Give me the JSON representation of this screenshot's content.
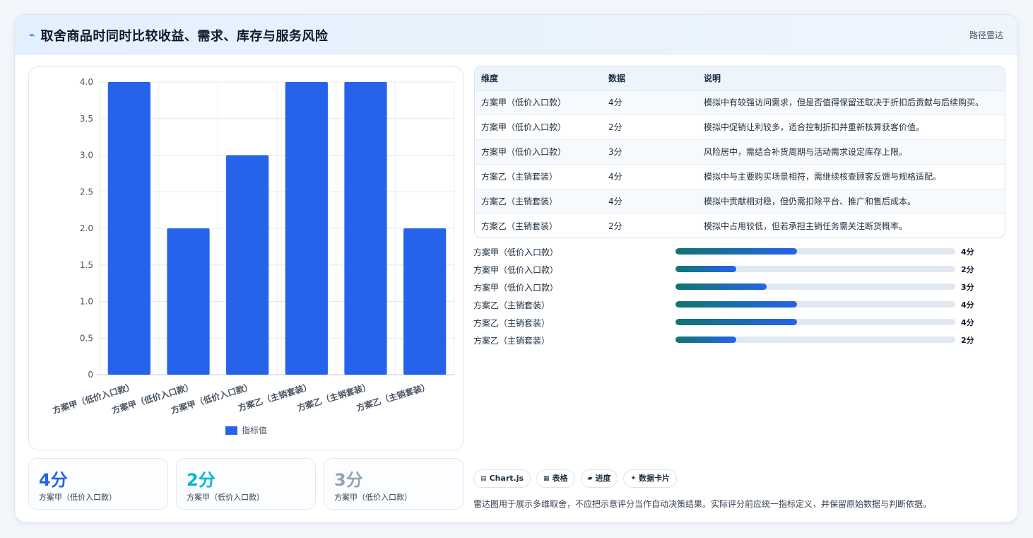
{
  "header": {
    "title": "取舍商品时同时比较收益、需求、库存与服务风险",
    "badge": "路径雷达",
    "title_icon": "trend-icon"
  },
  "chart_data": {
    "type": "bar",
    "categories": [
      "方案甲（低价入口款）",
      "方案甲（低价入口款）",
      "方案甲（低价入口款）",
      "方案乙（主销套装）",
      "方案乙（主销套装）",
      "方案乙（主销套装）"
    ],
    "series": [
      {
        "name": "指标值",
        "values": [
          4,
          2,
          3,
          4,
          4,
          2
        ]
      }
    ],
    "ylim": [
      0,
      4
    ],
    "yticks": [
      "0",
      "0.5",
      "1.0",
      "1.5",
      "2.0",
      "2.5",
      "3.0",
      "3.5",
      "4.0"
    ],
    "grid": true,
    "legend": "bottom",
    "bar_color": "#2563eb"
  },
  "stats": [
    {
      "value": "4分",
      "label": "方案甲（低价入口款）",
      "color": "#2563eb"
    },
    {
      "value": "2分",
      "label": "方案甲（低价入口款）",
      "color": "#06b6d4"
    },
    {
      "value": "3分",
      "label": "方案甲（低价入口款）",
      "color": "#94a3b8"
    }
  ],
  "table": {
    "headers": [
      "维度",
      "数据",
      "说明"
    ],
    "rows": [
      [
        "方案甲（低价入口款）",
        "4分",
        "模拟中有较强访问需求，但是否值得保留还取决于折扣后贡献与后续购买。"
      ],
      [
        "方案甲（低价入口款）",
        "2分",
        "模拟中促销让利较多，适合控制折扣并重新核算获客价值。"
      ],
      [
        "方案甲（低价入口款）",
        "3分",
        "风险居中，需结合补货周期与活动需求设定库存上限。"
      ],
      [
        "方案乙（主销套装）",
        "4分",
        "模拟中与主要购买场景相符，需继续核查顾客反馈与规格适配。"
      ],
      [
        "方案乙（主销套装）",
        "4分",
        "模拟中贡献相对稳，但仍需扣除平台、推广和售后成本。"
      ],
      [
        "方案乙（主销套装）",
        "2分",
        "模拟中占用较低，但若承担主销任务需关注断货概率。"
      ]
    ]
  },
  "progress": {
    "max": 4,
    "items": [
      {
        "label": "方案甲（低价入口款）",
        "value": 4,
        "text": "4分"
      },
      {
        "label": "方案甲（低价入口款）",
        "value": 2,
        "text": "2分"
      },
      {
        "label": "方案甲（低价入口款）",
        "value": 3,
        "text": "3分"
      },
      {
        "label": "方案乙（主销套装）",
        "value": 4,
        "text": "4分"
      },
      {
        "label": "方案乙（主销套装）",
        "value": 4,
        "text": "4分"
      },
      {
        "label": "方案乙（主销套装）",
        "value": 2,
        "text": "2分"
      }
    ]
  },
  "chips": [
    {
      "icon": "chart-icon",
      "glyph": "▤",
      "label": "Chart.js"
    },
    {
      "icon": "table-icon",
      "glyph": "▦",
      "label": "表格"
    },
    {
      "icon": "progress-icon",
      "glyph": "▰",
      "label": "进度"
    },
    {
      "icon": "card-icon",
      "glyph": "✦",
      "label": "数据卡片"
    }
  ],
  "note": "雷达图用于展示多维取舍，不应把示意评分当作自动决策结果。实际评分前应统一指标定义，并保留原始数据与判断依据。"
}
